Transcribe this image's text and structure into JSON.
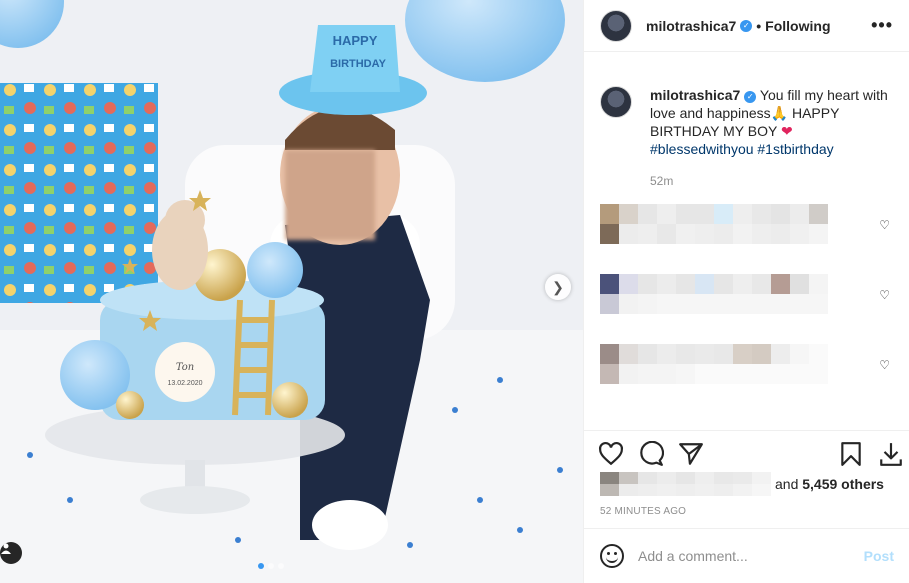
{
  "post": {
    "username": "milotrashica7",
    "verified_icon": "verified-badge-icon",
    "separator": "•",
    "follow_status": "Following",
    "more_icon": "•••",
    "cake_plaque_name": "Ton",
    "cake_plaque_date": "13.02.2020",
    "hat_text_top": "HAPPY",
    "hat_text_bottom": "BIRTHDAY"
  },
  "caption": {
    "username": "milotrashica7",
    "text_part1": " You fill my heart with love and happiness",
    "emoji_pray": "🙏",
    "text_part2": " HAPPY BIRTHDAY MY BOY ",
    "emoji_heart": "❤",
    "hashtags": "#blessedwithyou #1stbirthday",
    "time_ago": "52m"
  },
  "likes": {
    "and_text": "and ",
    "others_count": "5,459 others"
  },
  "post_time": "52 MINUTES AGO",
  "add_comment": {
    "placeholder": "Add a comment...",
    "post_label": "Post"
  },
  "colors": {
    "link_blue": "#00376b",
    "accent_blue": "#3897f0",
    "post_disabled": "#b2dffc"
  }
}
